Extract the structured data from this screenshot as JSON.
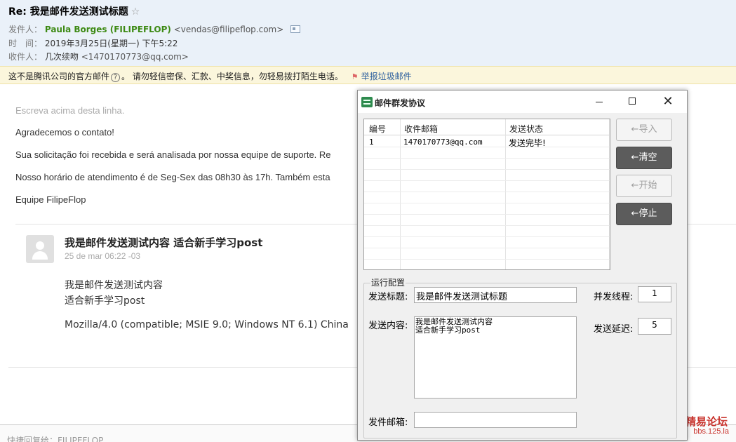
{
  "email": {
    "subject": "Re: 我是邮件发送测试标题",
    "star": "☆",
    "from_label": "发件人：",
    "from_name": "Paula Borges (FILIPEFLOP)",
    "from_addr": "<vendas@filipeflop.com>",
    "time_label": "时　间：",
    "time_value": "2019年3月25日(星期一) 下午5:22",
    "to_label": "收件人：",
    "to_name": "几次续吻",
    "to_addr": "<1470170773@qq.com>",
    "warning_a": "这不是腾讯公司的官方邮件",
    "warning_q": "?",
    "warning_b": "。 请勿轻信密保、汇款、中奖信息，勿轻易拨打陌生电话。",
    "report_label": "举报垃圾邮件",
    "body": [
      "Escreva acima desta linha.",
      "Agradecemos o contato!",
      "Sua solicitação foi recebida e será analisada por nossa equipe de suporte. Re",
      "Nosso horário de atendimento é de Seg-Sex das 08h30 às 17h. Também esta",
      "Equipe FilipeFlop"
    ],
    "quote": {
      "title": "我是邮件发送测试内容 适合新手学习post",
      "date": "25 de mar 06:22 -03",
      "lines": [
        "我是邮件发送测试内容",
        "适合新手学习post",
        "Mozilla/4.0 (compatible; MSIE 9.0; Windows NT 6.1) China"
      ]
    },
    "reply_placeholder": "快捷回复给：FILIPEFLOP"
  },
  "watermark": {
    "line1": "精易论坛",
    "line2": "bbs.125.la"
  },
  "dialog": {
    "title": "邮件群发协议",
    "minimize": "—",
    "maximize": "☐",
    "close": "✕",
    "columns": [
      "编号",
      "收件邮箱",
      "发送状态"
    ],
    "rows": [
      {
        "id": "1",
        "email": "1470170773@qq.com",
        "status": "发送完毕!"
      }
    ],
    "buttons": {
      "import": "←导入",
      "clear": "←清空",
      "start": "←开始",
      "stop": "←停止"
    },
    "config_legend": "运行配置",
    "subject_label": "发送标题:",
    "subject_value": "我是邮件发送测试标题",
    "threads_label": "并发线程:",
    "threads_value": "1",
    "content_label": "发送内容:",
    "content_value": "我是邮件发送测试内容\n适合新手学习post",
    "delay_label": "发送延迟:",
    "delay_value": "5",
    "sender_label": "发件邮箱:",
    "sender_value": ""
  },
  "colors": {
    "header_bg": "#eaf1f9",
    "sender_green": "#3d8a14",
    "warn_bg": "#fbf6dc",
    "button_dark": "#5c5c5c"
  }
}
